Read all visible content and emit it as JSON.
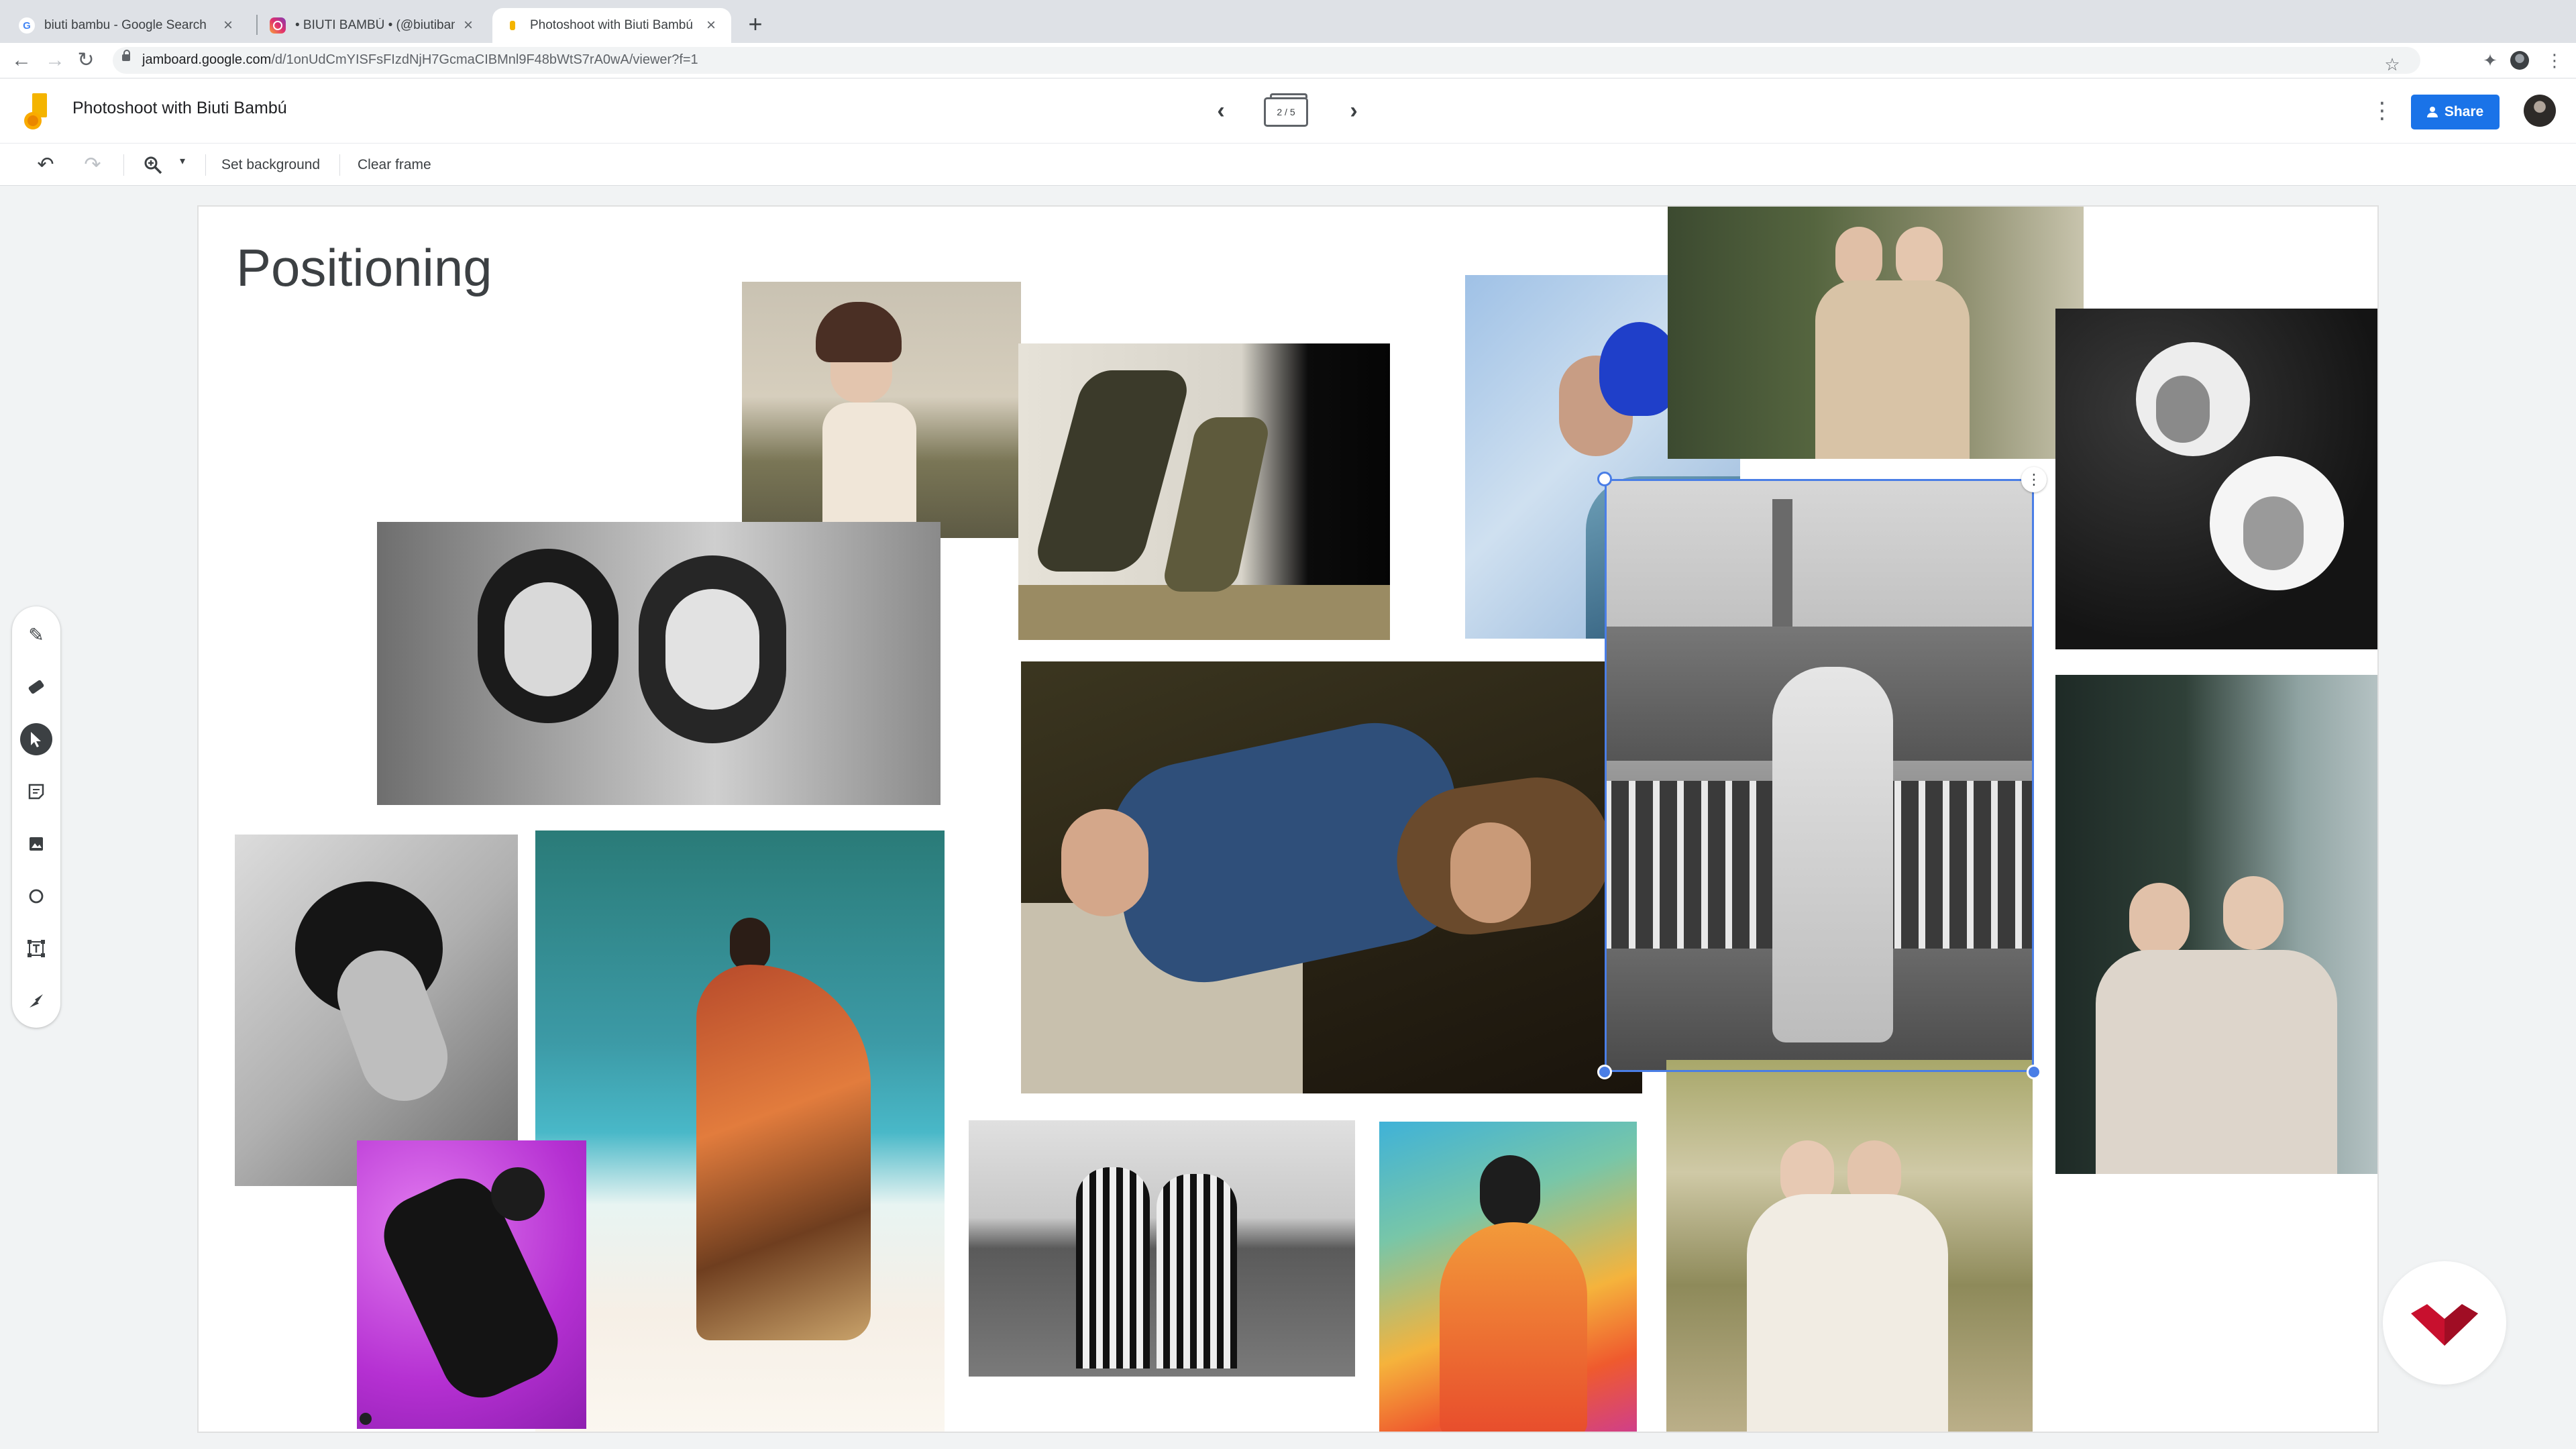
{
  "browser": {
    "tabs": [
      {
        "title": "biuti bambu - Google Search",
        "favicon": "google-icon",
        "active": false
      },
      {
        "title": "• BIUTI BAMBÚ • (@biutibambu)",
        "favicon": "instagram-icon",
        "active": false
      },
      {
        "title": "Photoshoot with Biuti Bambú",
        "favicon": "jamboard-icon",
        "active": true
      }
    ],
    "url_host": "jamboard.google.com",
    "url_path": "/d/1onUdCmYISFsFIzdNjH7GcmaCIBMnl9F48bWtS7rA0wA/viewer?f=1"
  },
  "app": {
    "document_title": "Photoshoot with Biuti Bambú",
    "frame_indicator": "2 / 5",
    "share_label": "Share"
  },
  "toolbar": {
    "set_background_label": "Set background",
    "clear_frame_label": "Clear frame",
    "zoom_caret": "▾"
  },
  "tools": [
    {
      "name": "pen-tool",
      "icon": "pen-icon",
      "selected": false
    },
    {
      "name": "eraser-tool",
      "icon": "eraser-icon",
      "selected": false
    },
    {
      "name": "select-tool",
      "icon": "cursor-icon",
      "selected": true
    },
    {
      "name": "sticky-note-tool",
      "icon": "sticky-note-icon",
      "selected": false
    },
    {
      "name": "add-image-tool",
      "icon": "image-icon",
      "selected": false
    },
    {
      "name": "circle-tool",
      "icon": "circle-icon",
      "selected": false
    },
    {
      "name": "text-box-tool",
      "icon": "text-box-icon",
      "selected": false
    },
    {
      "name": "laser-tool",
      "icon": "laser-icon",
      "selected": false
    }
  ],
  "board": {
    "title": "Positioning",
    "photos": [
      {
        "name": "photo-woman-ruffle-blouse",
        "tone": "warm"
      },
      {
        "name": "photo-two-women-running",
        "tone": "color"
      },
      {
        "name": "photo-woman-blue-flower",
        "tone": "color"
      },
      {
        "name": "photo-two-women-greenhouse",
        "tone": "warm"
      },
      {
        "name": "photo-fur-hoods-bw",
        "tone": "bw"
      },
      {
        "name": "photo-two-women-bw-portrait",
        "tone": "bw"
      },
      {
        "name": "photo-women-lying-grass",
        "tone": "warm"
      },
      {
        "name": "photo-dancer-city-rooftop-bw",
        "tone": "bw"
      },
      {
        "name": "photo-two-women-window",
        "tone": "cool"
      },
      {
        "name": "photo-curly-hair-bw",
        "tone": "bw"
      },
      {
        "name": "photo-beach-floral-dress",
        "tone": "color"
      },
      {
        "name": "photo-dancer-purple",
        "tone": "color"
      },
      {
        "name": "photo-two-men-sea-bw",
        "tone": "bw"
      },
      {
        "name": "photo-colorful-dress",
        "tone": "color"
      },
      {
        "name": "photo-two-women-field",
        "tone": "warm"
      }
    ]
  },
  "colors": {
    "accent": "#1a73e8",
    "selection": "#4a7ee6",
    "watermark": "#c8102e"
  }
}
